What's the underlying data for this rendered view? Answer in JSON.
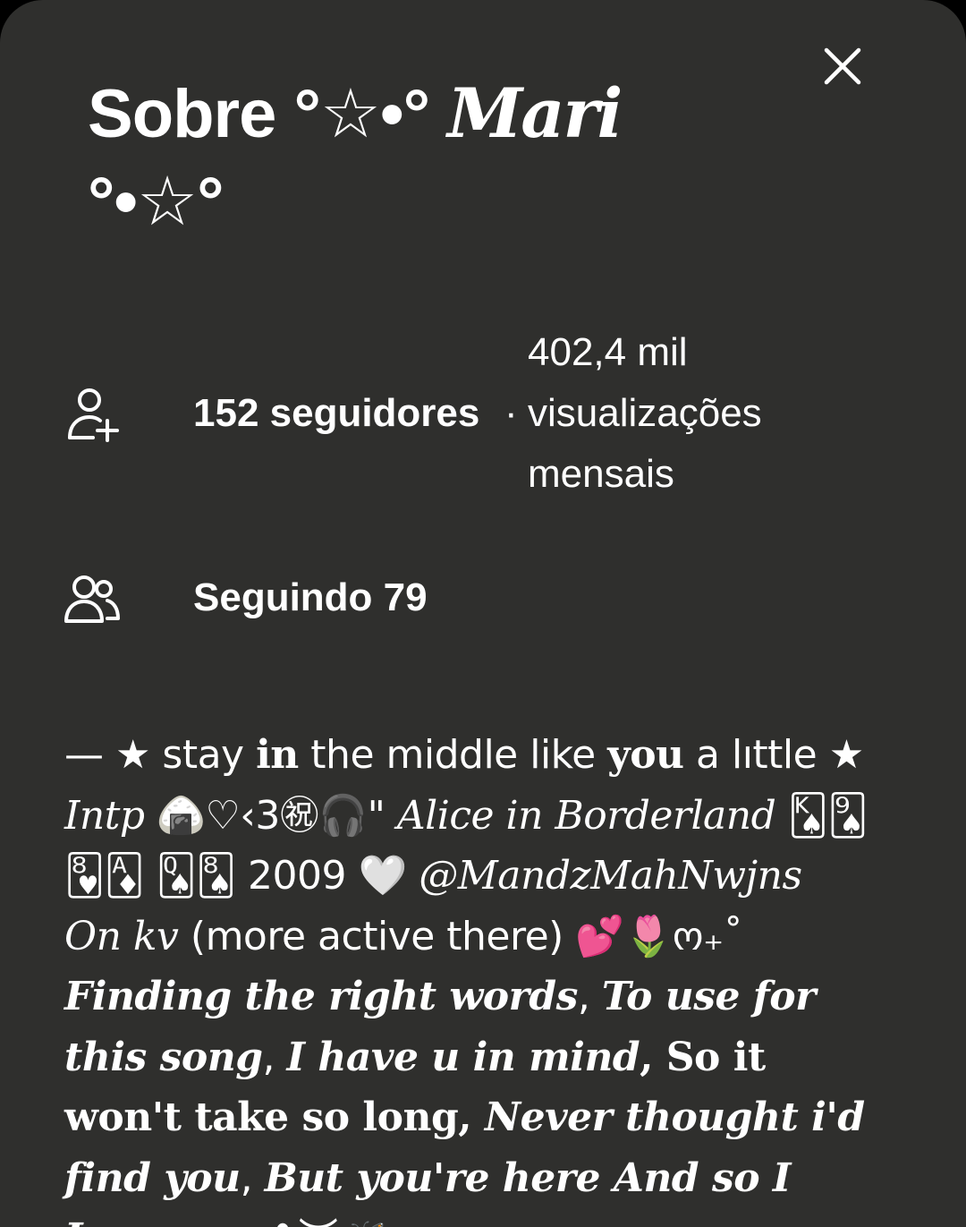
{
  "header": {
    "title_prefix": "Sobre °☆•° ",
    "title_name": "Mari",
    "title_suffix": " °•☆°"
  },
  "stats": {
    "followers_count_label": "152 seguidores",
    "separator": "·",
    "views_line1": "402,4 mil",
    "views_line2": "visualizações",
    "views_line3": "mensais",
    "following_label": "Seguindo 79"
  },
  "bio": {
    "seg1": "— ★ stay ",
    "seg2": "in",
    "seg3": " the middle like ",
    "seg4": "you",
    "seg5": " a lıttle ★ ",
    "seg6": "Intp",
    "seg7": " 🍙♡‹3㊗🎧\" ",
    "seg8": "Alice in Borderland",
    "seg9": " 🂮🂩🂸🃁 🂭🂨 2009 🤍 ",
    "seg10": "@MandzMahNwjns On kv",
    "seg11": " (more active there) 💕🌷ო₊˚ ",
    "seg12": "Finding the right words",
    "seg13": ", ",
    "seg14": "To use for this song",
    "seg15": ", ",
    "seg16": "I have u in mind",
    "seg17": ", So it won't take so long, ",
    "seg18": "Never thought i'd find you",
    "seg19": ", ",
    "seg20": "But you're here And so I Love you",
    "seg21": " ✿︶🦋"
  },
  "icons": {
    "close": "close-icon",
    "add_person": "add-person-icon",
    "people": "people-icon"
  }
}
